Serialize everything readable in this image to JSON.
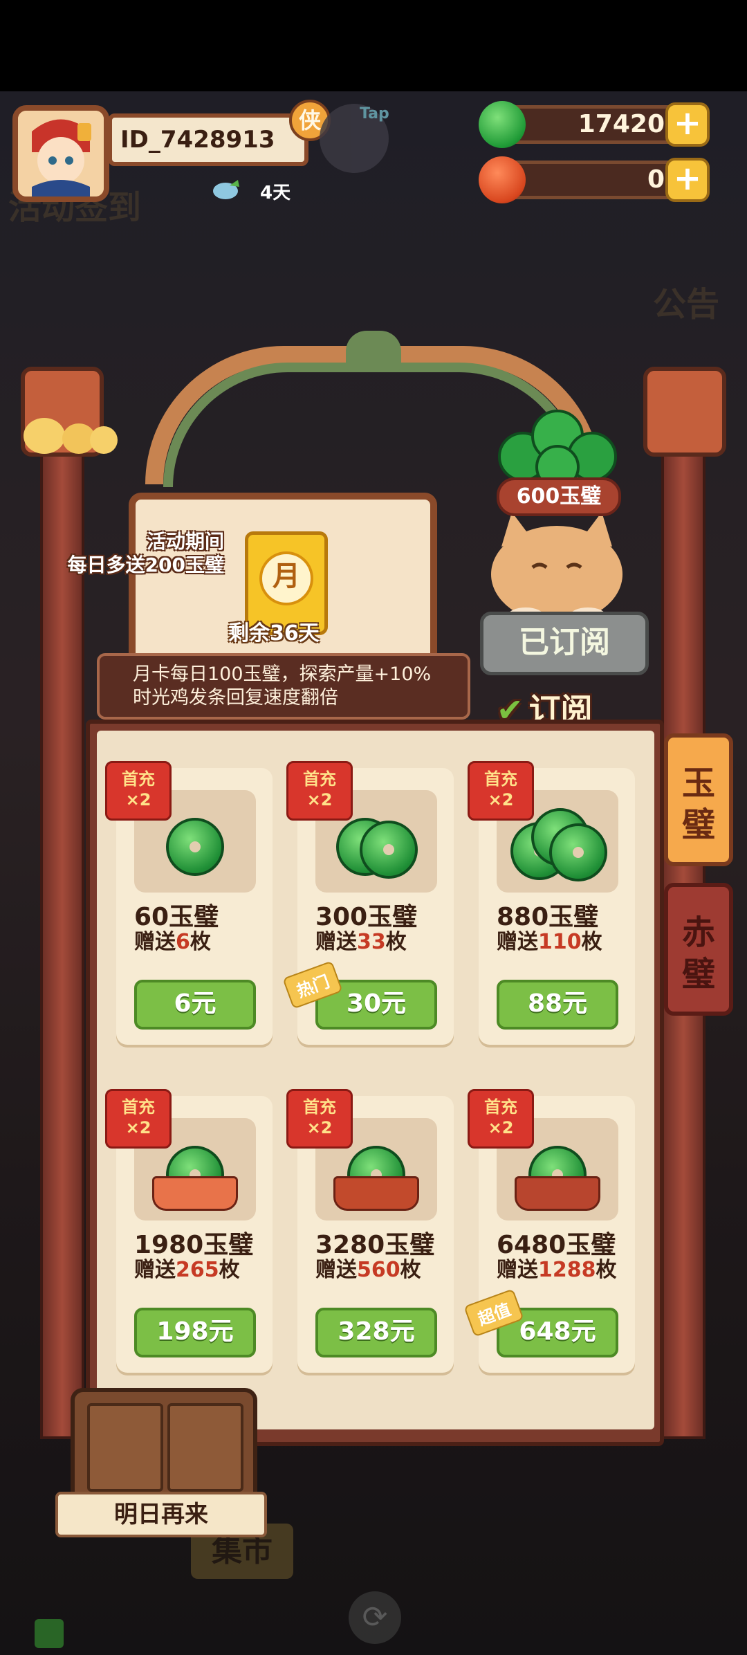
{
  "player": {
    "id": "ID_7428913",
    "badge": "侠",
    "tap_label": "Tap",
    "days": "4天"
  },
  "currencies": [
    {
      "name": "jade",
      "amount": "17420",
      "color": "#2fa83d"
    },
    {
      "name": "red-jade",
      "amount": "0",
      "color": "#d8461e"
    }
  ],
  "background": {
    "left_sign": "活动签到",
    "right_sign": "公告"
  },
  "monthly_card": {
    "promo_line1": "活动期间",
    "promo_line2": "每日多送200玉璧",
    "icon_char": "月",
    "remaining": "剩余36天",
    "desc_line1": "月卡每日100玉璧，探索产量+10%",
    "desc_line2": "时光鸡发条回复速度翻倍",
    "reward_label": "600玉璧",
    "subscribed_button": "已订阅",
    "subscribe_tab": "订阅"
  },
  "shop": {
    "first_badge_line1": "首充",
    "first_badge_line2": "×2",
    "items": [
      {
        "name": "60玉璧",
        "gift_prefix": "赠送",
        "gift_num": "6",
        "gift_suffix": "枚",
        "price": "6元",
        "tag": ""
      },
      {
        "name": "300玉璧",
        "gift_prefix": "赠送",
        "gift_num": "33",
        "gift_suffix": "枚",
        "price": "30元",
        "tag": "热门"
      },
      {
        "name": "880玉璧",
        "gift_prefix": "赠送",
        "gift_num": "110",
        "gift_suffix": "枚",
        "price": "88元",
        "tag": ""
      },
      {
        "name": "1980玉璧",
        "gift_prefix": "赠送",
        "gift_num": "265",
        "gift_suffix": "枚",
        "price": "198元",
        "tag": ""
      },
      {
        "name": "3280玉璧",
        "gift_prefix": "赠送",
        "gift_num": "560",
        "gift_suffix": "枚",
        "price": "328元",
        "tag": ""
      },
      {
        "name": "6480玉璧",
        "gift_prefix": "赠送",
        "gift_num": "1288",
        "gift_suffix": "枚",
        "price": "648元",
        "tag": "超值"
      }
    ]
  },
  "tabs": [
    {
      "label_top": "玉",
      "label_bottom": "璧"
    },
    {
      "label_top": "赤",
      "label_bottom": "璧"
    }
  ],
  "bottom": {
    "tomorrow": "明日再来",
    "market": "集市"
  }
}
